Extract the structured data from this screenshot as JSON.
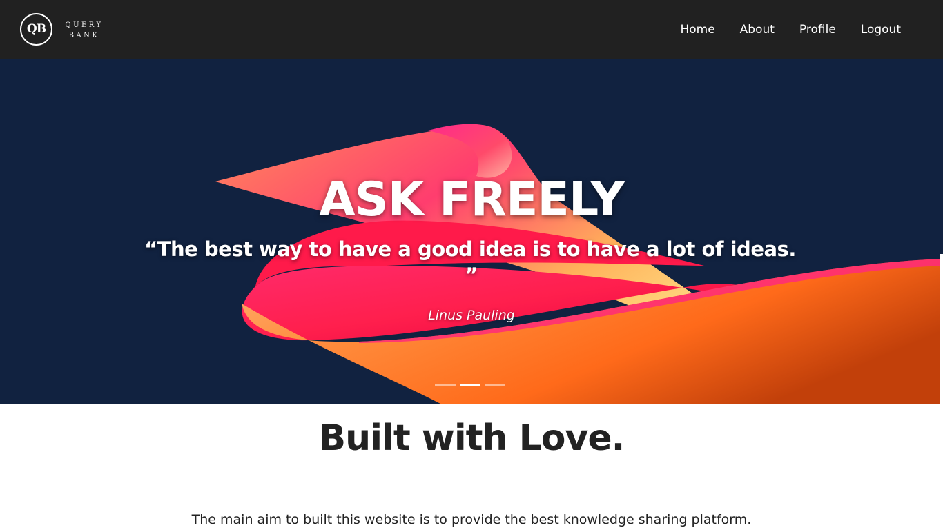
{
  "brand": {
    "logo_initials": "QB",
    "name_line1": "QUERY",
    "name_line2": "BANK"
  },
  "nav": {
    "items": [
      {
        "label": "Home"
      },
      {
        "label": "About"
      },
      {
        "label": "Profile"
      },
      {
        "label": "Logout"
      }
    ]
  },
  "hero": {
    "title": "ASK FREELY",
    "quote": "“The best way to have a good idea is to have a lot of ideas.",
    "quote_close": "”",
    "author": "Linus Pauling",
    "slide_count": 3,
    "active_slide": 2
  },
  "section": {
    "heading": "Built with Love.",
    "text": "The main aim to built this website is to provide the best knowledge sharing platform."
  },
  "colors": {
    "navbar_bg": "#212121",
    "hero_bg": "#112240",
    "ribbon_pink": "#ff1a5e",
    "ribbon_orange": "#ff7a2a",
    "text_dark": "#222222"
  }
}
